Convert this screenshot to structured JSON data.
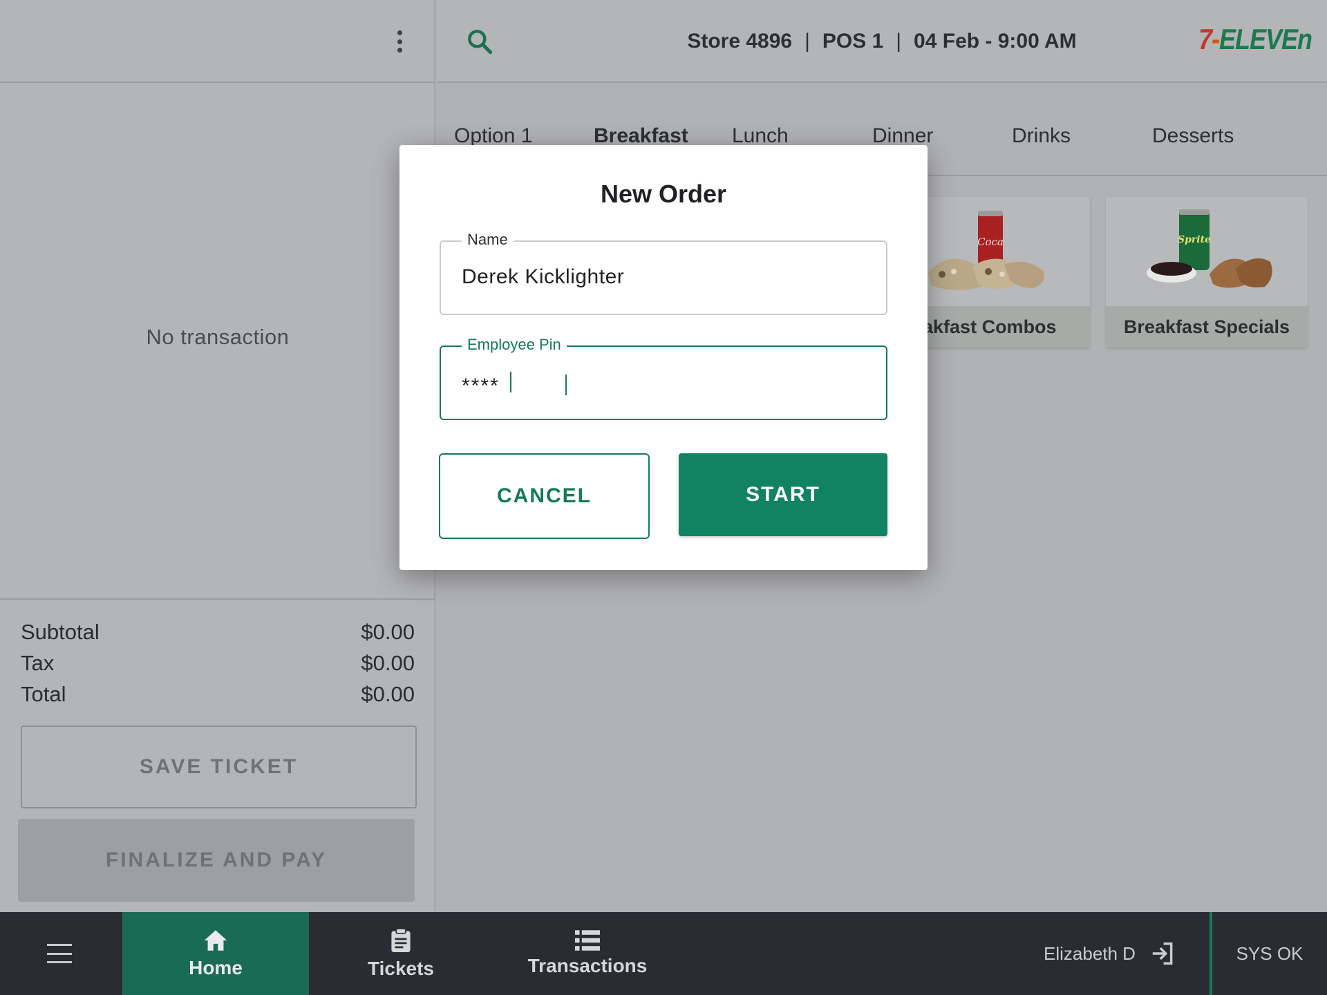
{
  "left_panel": {
    "empty_text": "No transaction",
    "totals": [
      {
        "label": "Subtotal",
        "value": "$0.00"
      },
      {
        "label": "Tax",
        "value": "$0.00"
      },
      {
        "label": "Total",
        "value": "$0.00"
      }
    ],
    "save_ticket_label": "SAVE TICKET",
    "finalize_label": "FINALIZE AND PAY"
  },
  "header": {
    "store": "Store 4896",
    "pos": "POS 1",
    "datetime": "04 Feb - 9:00 AM",
    "separator": "|",
    "brand": {
      "seven": "7",
      "dash": "-",
      "eleven": "ELEVEn"
    }
  },
  "tabs": [
    {
      "label": "Option 1",
      "active": false
    },
    {
      "label": "Breakfast",
      "active": true
    },
    {
      "label": "Lunch",
      "active": false
    },
    {
      "label": "Dinner",
      "active": false
    },
    {
      "label": "Drinks",
      "active": false
    },
    {
      "label": "Desserts",
      "active": false
    }
  ],
  "products": [
    {
      "label": "Breakfast Combos",
      "image": "cola-and-burritos"
    },
    {
      "label": "Breakfast Specials",
      "image": "sprite-and-burritos"
    }
  ],
  "modal": {
    "title": "New Order",
    "name_label": "Name",
    "name_value": "Derek Kicklighter",
    "pin_label": "Employee Pin",
    "pin_value": "****",
    "cancel_label": "CANCEL",
    "start_label": "START"
  },
  "bottom_nav": {
    "items": [
      {
        "label": "Home",
        "icon": "home-icon",
        "active": true
      },
      {
        "label": "Tickets",
        "icon": "clipboard-icon",
        "active": false
      },
      {
        "label": "Transactions",
        "icon": "list-icon",
        "active": false
      }
    ],
    "user_name": "Elizabeth D",
    "status": "SYS OK"
  },
  "colors": {
    "accent": "#128264",
    "nav_bg": "#292c33",
    "nav_active": "#1a6b55",
    "overlay_bg": "#b1b2b4"
  }
}
